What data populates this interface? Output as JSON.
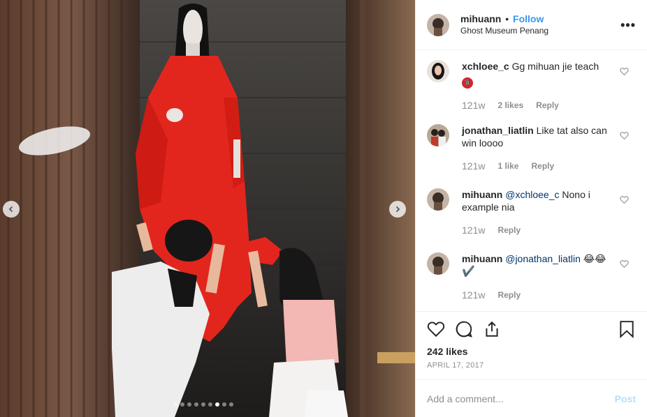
{
  "media": {
    "photo_description_icon": "ghost-museum-photo",
    "carousel_total": 9,
    "carousel_active": 7
  },
  "header": {
    "username": "mihuann",
    "bullet": "•",
    "follow_label": "Follow",
    "location": "Ghost Museum Penang",
    "more_label": "•••"
  },
  "comments": [
    {
      "user": "xchloee_c",
      "text": "Gg mihuan jie teach",
      "emoji": "🔞",
      "time": "121w",
      "likes": "2 likes",
      "reply": "Reply"
    },
    {
      "user": "jonathan_liatlin",
      "text": "Like tat also can win loooo",
      "time": "121w",
      "likes": "1 like",
      "reply": "Reply"
    },
    {
      "user": "mihuann",
      "mention": "@xchloee_c",
      "text": "Nono i example nia",
      "time": "121w",
      "reply": "Reply"
    },
    {
      "user": "mihuann",
      "mention": "@jonathan_liatlin",
      "emoji": "😂😂",
      "emoji2": "✔️",
      "time": "121w",
      "reply": "Reply"
    }
  ],
  "actions": {
    "likes": "242 likes",
    "date": "APRIL 17, 2017"
  },
  "add_comment": {
    "placeholder": "Add a comment...",
    "post_label": "Post"
  },
  "colors": {
    "accent": "#3897f0",
    "post_disabled": "#b2dffc",
    "muted": "#8e8e8e"
  }
}
